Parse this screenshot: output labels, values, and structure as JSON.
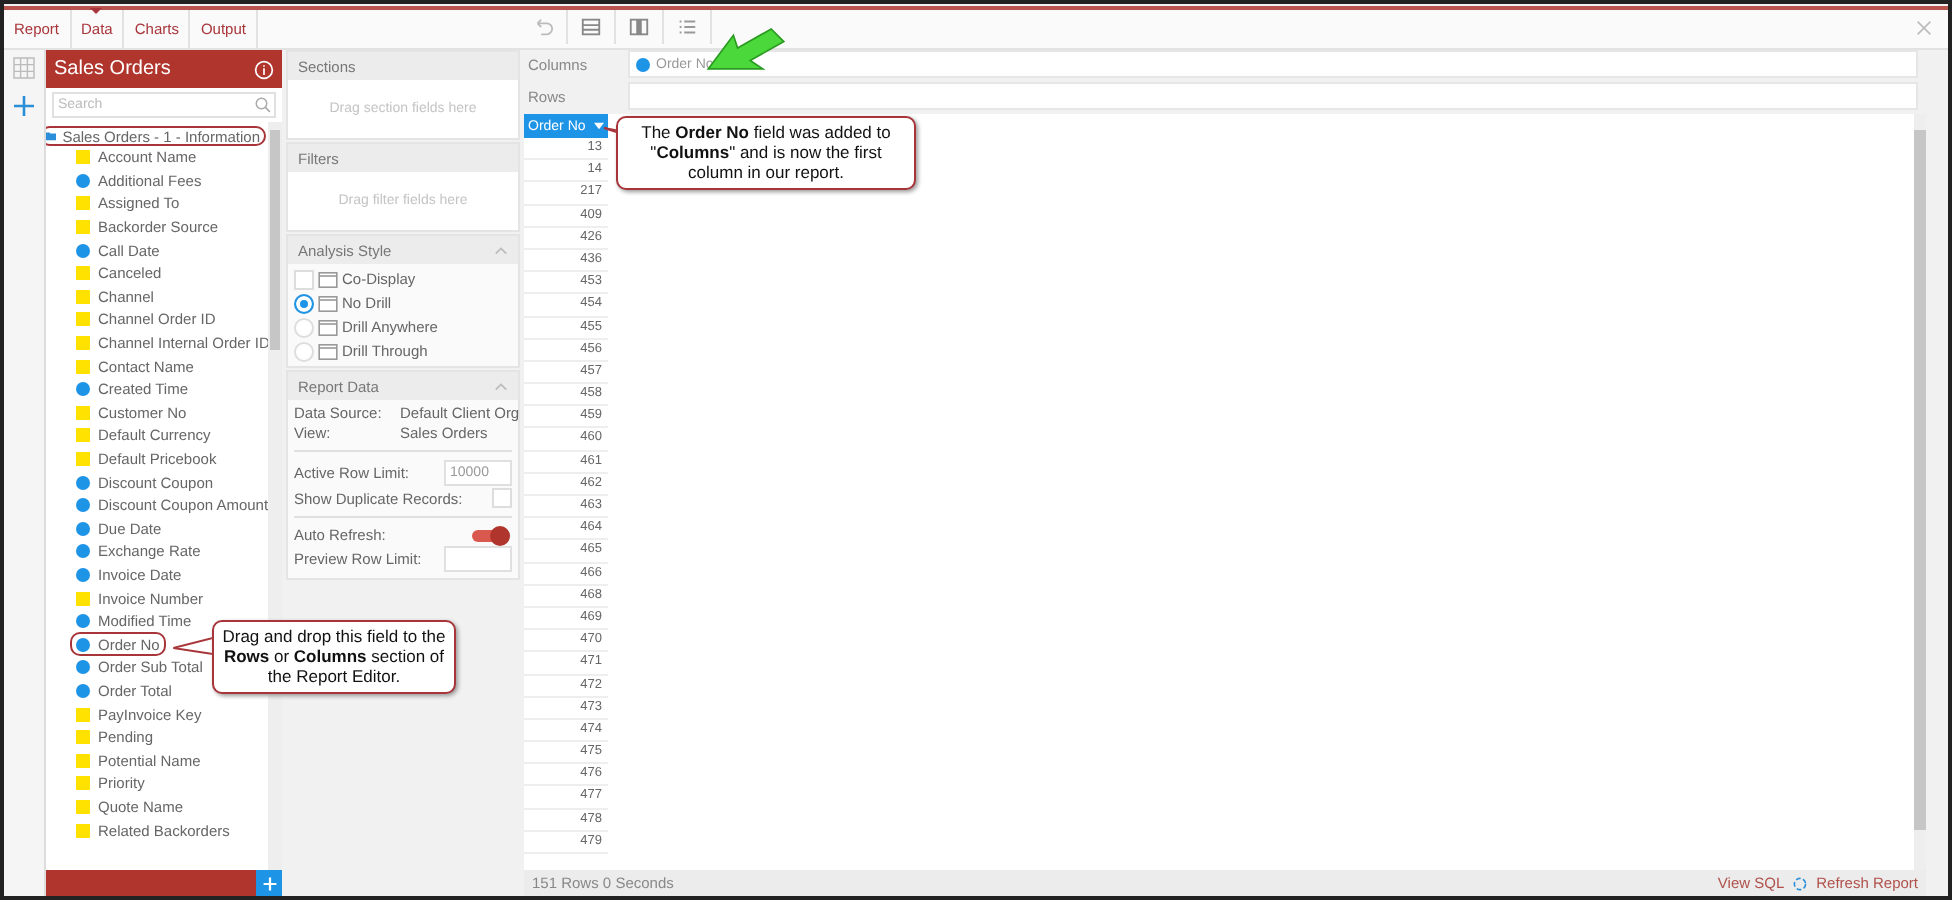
{
  "tabs": [
    {
      "label": "Report",
      "selected": false
    },
    {
      "label": "Data",
      "selected": true
    },
    {
      "label": "Charts",
      "selected": false
    },
    {
      "label": "Output",
      "selected": false
    }
  ],
  "fields_panel": {
    "title": "Sales Orders",
    "search": {
      "placeholder": "Search"
    },
    "root": {
      "label": "Sales Orders - 1 - Information",
      "expanded": true,
      "children": [
        {
          "label": "Account Name",
          "kind": "text",
          "selected": false
        },
        {
          "label": "Additional Fees",
          "kind": "number",
          "selected": false
        },
        {
          "label": "Assigned To",
          "kind": "text",
          "selected": false
        },
        {
          "label": "Backorder Source",
          "kind": "text",
          "selected": false
        },
        {
          "label": "Call Date",
          "kind": "number",
          "selected": false
        },
        {
          "label": "Canceled",
          "kind": "text",
          "selected": false
        },
        {
          "label": "Channel",
          "kind": "text",
          "selected": false
        },
        {
          "label": "Channel Order ID",
          "kind": "text",
          "selected": false
        },
        {
          "label": "Channel Internal Order ID",
          "kind": "text",
          "selected": false
        },
        {
          "label": "Contact Name",
          "kind": "text",
          "selected": false
        },
        {
          "label": "Created Time",
          "kind": "number",
          "selected": false
        },
        {
          "label": "Customer No",
          "kind": "text",
          "selected": false
        },
        {
          "label": "Default Currency",
          "kind": "text",
          "selected": false
        },
        {
          "label": "Default Pricebook",
          "kind": "text",
          "selected": false
        },
        {
          "label": "Discount Coupon",
          "kind": "number",
          "selected": false
        },
        {
          "label": "Discount Coupon Amount",
          "kind": "number",
          "selected": false
        },
        {
          "label": "Due Date",
          "kind": "number",
          "selected": false
        },
        {
          "label": "Exchange Rate",
          "kind": "number",
          "selected": false
        },
        {
          "label": "Invoice Date",
          "kind": "number",
          "selected": false
        },
        {
          "label": "Invoice Number",
          "kind": "text",
          "selected": false
        },
        {
          "label": "Modified Time",
          "kind": "number",
          "selected": false
        },
        {
          "label": "Order No",
          "kind": "number",
          "selected": true
        },
        {
          "label": "Order Sub Total",
          "kind": "number",
          "selected": false
        },
        {
          "label": "Order Total",
          "kind": "number",
          "selected": false
        },
        {
          "label": "PayInvoice Key",
          "kind": "text",
          "selected": false
        },
        {
          "label": "Pending",
          "kind": "text",
          "selected": false
        },
        {
          "label": "Potential Name",
          "kind": "text",
          "selected": false
        },
        {
          "label": "Priority",
          "kind": "text",
          "selected": false
        },
        {
          "label": "Quote Name",
          "kind": "text",
          "selected": false
        },
        {
          "label": "Related Backorders",
          "kind": "text",
          "selected": false
        }
      ]
    }
  },
  "sections": {
    "title": "Sections",
    "hint": "Drag section fields here"
  },
  "filters": {
    "title": "Filters",
    "hint": "Drag filter fields here"
  },
  "analysis_style": {
    "title": "Analysis Style",
    "options": [
      {
        "label": "Co-Display",
        "kind": "checkbox",
        "selected": false
      },
      {
        "label": "No Drill",
        "kind": "radio",
        "selected": true
      },
      {
        "label": "Drill Anywhere",
        "kind": "radio",
        "selected": false
      },
      {
        "label": "Drill Through",
        "kind": "radio",
        "selected": false
      }
    ]
  },
  "report_data": {
    "title": "Report Data",
    "info": [
      {
        "label": "Data Source:",
        "value": "Default Client Org"
      },
      {
        "label": "View:",
        "value": "Sales Orders"
      }
    ],
    "active_row_limit": {
      "label": "Active Row Limit:",
      "value": "10000"
    },
    "show_duplicate_records": {
      "label": "Show Duplicate Records:",
      "checked": false
    },
    "auto_refresh": {
      "label": "Auto Refresh:",
      "on": true
    },
    "preview_row_limit": {
      "label": "Preview Row Limit:"
    }
  },
  "columns": {
    "label": "Columns",
    "fields": [
      "Order No"
    ]
  },
  "rows": {
    "label": "Rows"
  },
  "table": {
    "column": "Order No",
    "rows": [
      "13",
      "14",
      "217",
      "409",
      "426",
      "436",
      "453",
      "454",
      "455",
      "456",
      "457",
      "458",
      "459",
      "460",
      "461",
      "462",
      "463",
      "464",
      "465",
      "466",
      "468",
      "469",
      "470",
      "471",
      "472",
      "473",
      "474",
      "475",
      "476",
      "477",
      "478",
      "479"
    ]
  },
  "status_bar": {
    "summary": "151 Rows  0 Seconds",
    "view_sql": "View SQL",
    "refresh": "Refresh Report"
  },
  "callouts": [
    {
      "text": "The **Order No** field was added to \"**Columns**\" and is now the first column in our report."
    },
    {
      "text": "Drag and drop this field to the **Rows** or **Columns** section of the Report Editor."
    }
  ]
}
